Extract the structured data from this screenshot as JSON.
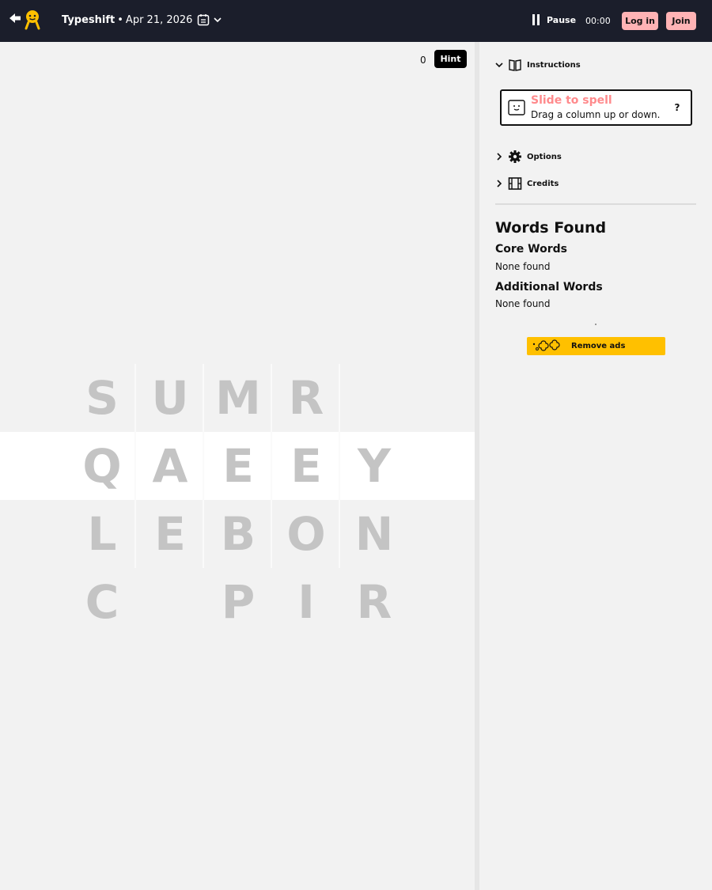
{
  "header": {
    "game_name": "Typeshift",
    "separator": "•",
    "date": "Apr 21, 2026",
    "pause_label": "Pause",
    "timer": "00:00",
    "login_label": "Log in",
    "join_label": "Join"
  },
  "hint": {
    "count": "0",
    "label": "Hint"
  },
  "board": {
    "columns": [
      {
        "letters": [
          "S",
          "Q",
          "L",
          "C"
        ],
        "selected_index": 1
      },
      {
        "letters": [
          "U",
          "A",
          "E"
        ],
        "selected_index": 1
      },
      {
        "letters": [
          "M",
          "E",
          "B",
          "P"
        ],
        "selected_index": 1
      },
      {
        "letters": [
          "R",
          "E",
          "O",
          "I"
        ],
        "selected_index": 1
      },
      {
        "letters": [
          "Y",
          "N",
          "R"
        ],
        "selected_index": 0
      }
    ]
  },
  "sidebar": {
    "instructions_label": "Instructions",
    "instr_title": "Slide to spell",
    "instr_sub": "Drag a column up or down.",
    "help_glyph": "?",
    "options_label": "Options",
    "credits_label": "Credits",
    "words_found_title": "Words Found",
    "core_words_title": "Core Words",
    "core_words_empty": "None found",
    "additional_words_title": "Additional Words",
    "additional_words_empty": "None found",
    "remove_ads_label": "Remove ads"
  },
  "colors": {
    "header_bg": "#1b1e2b",
    "accent_pink": "#ffb3b5",
    "instr_title": "#ff8a8c",
    "remove_ads_bg": "#ffc000",
    "letter": "#c4c4c4"
  }
}
